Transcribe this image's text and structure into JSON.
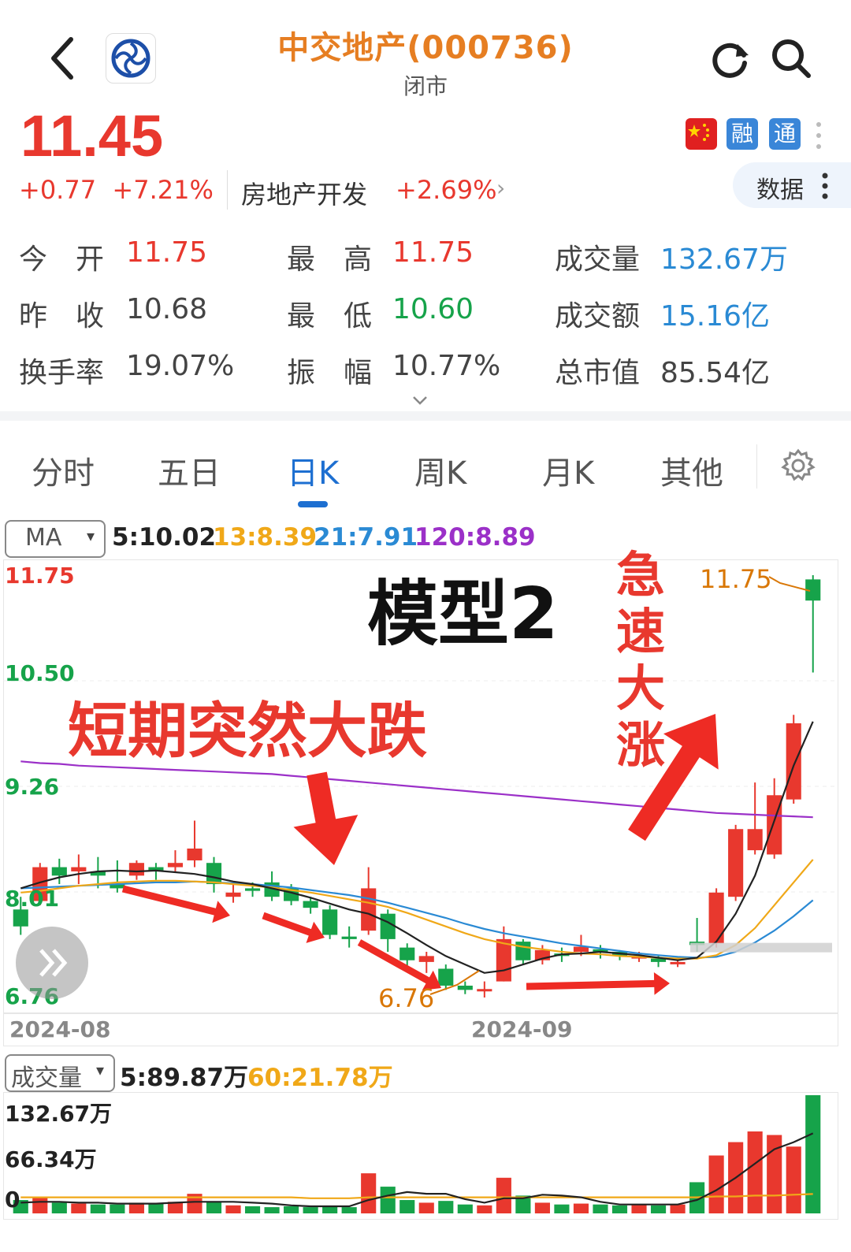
{
  "header": {
    "title": "中交地产(000736)",
    "status": "闭市"
  },
  "quote": {
    "price": "11.45",
    "change": "+0.77",
    "change_pct": "+7.21%",
    "sector": "房地产开发",
    "sector_change": "+2.69%",
    "badges": {
      "rong": "融",
      "tong": "通"
    },
    "data_button": "数据"
  },
  "stats": {
    "open_label": "今　开",
    "open_value": "11.75",
    "high_label": "最　高",
    "high_value": "11.75",
    "volume_label": "成交量",
    "volume_value": "132.67万",
    "prev_close_label": "昨　收",
    "prev_close_value": "10.68",
    "low_label": "最　低",
    "low_value": "10.60",
    "amount_label": "成交额",
    "amount_value": "15.16亿",
    "turnover_label": "换手率",
    "turnover_value": "19.07%",
    "amplitude_label": "振　幅",
    "amplitude_value": "10.77%",
    "mktcap_label": "总市值",
    "mktcap_value": "85.54亿"
  },
  "tabs": [
    "分时",
    "五日",
    "日K",
    "周K",
    "月K",
    "其他"
  ],
  "active_tab": "日K",
  "ma_selector": "MA",
  "ma_values": {
    "ma5": "5:10.02",
    "ma13": "13:8.39",
    "ma21": "21:7.91",
    "ma120": "120:8.89"
  },
  "volume_selector": "成交量",
  "volume_ma": {
    "v5": "5:89.87万",
    "v60": "60:21.78万"
  },
  "annotations": {
    "model": "模型2",
    "drop": "短期突然大跌",
    "surge_chars": [
      "急",
      "速",
      "大",
      "涨"
    ],
    "high_label": "11.75",
    "low_label": "6.76"
  },
  "colors": {
    "up": "#e8382e",
    "down": "#16a34a",
    "ma5": "#222222",
    "ma13": "#f0a818",
    "ma21": "#2a8ad4",
    "ma120": "#9b30c8",
    "title": "#e67e22"
  },
  "chart_data": {
    "type": "candlestick",
    "y_axis_labels": [
      "11.75",
      "10.50",
      "9.26",
      "8.01",
      "6.76"
    ],
    "ylim": [
      6.76,
      11.75
    ],
    "x_axis_labels": [
      "2024-08",
      "2024-09"
    ],
    "candles": [
      {
        "o": 7.8,
        "c": 7.6,
        "h": 7.95,
        "l": 7.5
      },
      {
        "o": 7.9,
        "c": 8.3,
        "h": 8.35,
        "l": 7.85
      },
      {
        "o": 8.3,
        "c": 8.2,
        "h": 8.4,
        "l": 8.1
      },
      {
        "o": 8.25,
        "c": 8.3,
        "h": 8.45,
        "l": 8.1
      },
      {
        "o": 8.25,
        "c": 8.2,
        "h": 8.42,
        "l": 8.05
      },
      {
        "o": 8.1,
        "c": 8.05,
        "h": 8.38,
        "l": 8.0
      },
      {
        "o": 8.2,
        "c": 8.35,
        "h": 8.38,
        "l": 8.15
      },
      {
        "o": 8.3,
        "c": 8.25,
        "h": 8.35,
        "l": 8.15
      },
      {
        "o": 8.3,
        "c": 8.35,
        "h": 8.5,
        "l": 8.25
      },
      {
        "o": 8.38,
        "c": 8.52,
        "h": 8.85,
        "l": 8.3
      },
      {
        "o": 8.35,
        "c": 8.1,
        "h": 8.42,
        "l": 8.0
      },
      {
        "o": 7.95,
        "c": 8.0,
        "h": 8.1,
        "l": 7.88
      },
      {
        "o": 8.05,
        "c": 8.02,
        "h": 8.12,
        "l": 7.95
      },
      {
        "o": 8.12,
        "c": 7.95,
        "h": 8.25,
        "l": 7.9
      },
      {
        "o": 8.05,
        "c": 7.9,
        "h": 8.1,
        "l": 7.85
      },
      {
        "o": 7.9,
        "c": 7.82,
        "h": 7.95,
        "l": 7.75
      },
      {
        "o": 7.8,
        "c": 7.5,
        "h": 7.85,
        "l": 7.45
      },
      {
        "o": 7.48,
        "c": 7.45,
        "h": 7.6,
        "l": 7.35
      },
      {
        "o": 7.55,
        "c": 8.05,
        "h": 8.3,
        "l": 7.5
      },
      {
        "o": 7.75,
        "c": 7.45,
        "h": 7.8,
        "l": 7.3
      },
      {
        "o": 7.35,
        "c": 7.2,
        "h": 7.4,
        "l": 7.1
      },
      {
        "o": 7.18,
        "c": 7.25,
        "h": 7.3,
        "l": 7.05
      },
      {
        "o": 7.1,
        "c": 6.9,
        "h": 7.15,
        "l": 6.85
      },
      {
        "o": 6.9,
        "c": 6.85,
        "h": 6.95,
        "l": 6.8
      },
      {
        "o": 6.84,
        "c": 6.86,
        "h": 6.95,
        "l": 6.76
      },
      {
        "o": 6.95,
        "c": 7.45,
        "h": 7.6,
        "l": 6.95
      },
      {
        "o": 7.42,
        "c": 7.2,
        "h": 7.45,
        "l": 7.15
      },
      {
        "o": 7.2,
        "c": 7.32,
        "h": 7.38,
        "l": 7.15
      },
      {
        "o": 7.28,
        "c": 7.25,
        "h": 7.35,
        "l": 7.18
      },
      {
        "o": 7.3,
        "c": 7.36,
        "h": 7.5,
        "l": 7.25
      },
      {
        "o": 7.33,
        "c": 7.3,
        "h": 7.38,
        "l": 7.22
      },
      {
        "o": 7.3,
        "c": 7.25,
        "h": 7.32,
        "l": 7.2
      },
      {
        "o": 7.22,
        "c": 7.25,
        "h": 7.3,
        "l": 7.18
      },
      {
        "o": 7.22,
        "c": 7.18,
        "h": 7.25,
        "l": 7.12
      },
      {
        "o": 7.16,
        "c": 7.18,
        "h": 7.22,
        "l": 7.12
      },
      {
        "o": 7.42,
        "c": 7.38,
        "h": 7.7,
        "l": 7.3
      },
      {
        "o": 7.4,
        "c": 8.0,
        "h": 8.05,
        "l": 7.35
      },
      {
        "o": 7.95,
        "c": 8.75,
        "h": 8.8,
        "l": 7.9
      },
      {
        "o": 8.5,
        "c": 8.75,
        "h": 9.3,
        "l": 8.45
      },
      {
        "o": 8.45,
        "c": 9.15,
        "h": 9.35,
        "l": 8.4
      },
      {
        "o": 9.1,
        "c": 10.0,
        "h": 10.1,
        "l": 9.05
      },
      {
        "o": 11.7,
        "c": 11.45,
        "h": 11.75,
        "l": 10.6
      }
    ],
    "ma5": [
      8.05,
      8.12,
      8.18,
      8.22,
      8.25,
      8.26,
      8.25,
      8.26,
      8.24,
      8.22,
      8.18,
      8.13,
      8.1,
      8.05,
      8.0,
      7.94,
      7.87,
      7.8,
      7.75,
      7.65,
      7.52,
      7.38,
      7.25,
      7.15,
      7.05,
      7.08,
      7.15,
      7.22,
      7.27,
      7.28,
      7.3,
      7.28,
      7.26,
      7.23,
      7.2,
      7.23,
      7.42,
      7.75,
      8.2,
      8.85,
      9.5,
      10.02
    ],
    "ma13": [
      8.0,
      8.02,
      8.05,
      8.08,
      8.1,
      8.12,
      8.13,
      8.14,
      8.14,
      8.13,
      8.12,
      8.1,
      8.08,
      8.06,
      8.03,
      8.0,
      7.96,
      7.92,
      7.88,
      7.83,
      7.76,
      7.68,
      7.6,
      7.52,
      7.45,
      7.4,
      7.36,
      7.33,
      7.3,
      7.28,
      7.27,
      7.25,
      7.24,
      7.23,
      7.22,
      7.22,
      7.26,
      7.38,
      7.58,
      7.85,
      8.12,
      8.39
    ],
    "ma21": [
      8.05,
      8.06,
      8.07,
      8.08,
      8.09,
      8.1,
      8.11,
      8.12,
      8.12,
      8.13,
      8.12,
      8.11,
      8.1,
      8.08,
      8.06,
      8.03,
      8.0,
      7.97,
      7.93,
      7.88,
      7.82,
      7.76,
      7.7,
      7.63,
      7.57,
      7.52,
      7.48,
      7.44,
      7.4,
      7.37,
      7.34,
      7.31,
      7.28,
      7.26,
      7.24,
      7.23,
      7.24,
      7.3,
      7.41,
      7.55,
      7.72,
      7.91
    ],
    "ma120": [
      9.55,
      9.53,
      9.52,
      9.5,
      9.49,
      9.48,
      9.47,
      9.46,
      9.45,
      9.44,
      9.43,
      9.42,
      9.41,
      9.4,
      9.38,
      9.36,
      9.34,
      9.32,
      9.3,
      9.28,
      9.26,
      9.24,
      9.22,
      9.2,
      9.18,
      9.16,
      9.14,
      9.12,
      9.1,
      9.08,
      9.06,
      9.04,
      9.02,
      9.0,
      8.98,
      8.96,
      8.94,
      8.93,
      8.92,
      8.91,
      8.9,
      8.89
    ],
    "volume_axis_labels": [
      "132.67万",
      "66.34万",
      "0"
    ],
    "volume_max": 132.67,
    "volumes": [
      15,
      18,
      12,
      11,
      10,
      10,
      12,
      11,
      13,
      22,
      13,
      9,
      8,
      7,
      8,
      7,
      8,
      7,
      45,
      30,
      15,
      12,
      14,
      10,
      9,
      40,
      20,
      12,
      10,
      11,
      10,
      9,
      10,
      9,
      10,
      35,
      65,
      80,
      92,
      88,
      75,
      132.67
    ],
    "volume_ma5": [
      12,
      13,
      13,
      12,
      12,
      11,
      11,
      11,
      12,
      13,
      13,
      13,
      12,
      11,
      9,
      8,
      8,
      8,
      15,
      20,
      24,
      22,
      22,
      16,
      12,
      17,
      17,
      21,
      20,
      18,
      13,
      10,
      10,
      10,
      10,
      15,
      26,
      40,
      56,
      72,
      80,
      89.87
    ],
    "volume_ma60": [
      18,
      18,
      18,
      18,
      18,
      18,
      18,
      18,
      18,
      18,
      18,
      18,
      18,
      18,
      18,
      17,
      17,
      17,
      18,
      18,
      18,
      18,
      18,
      18,
      18,
      18,
      18,
      18,
      18,
      18,
      18,
      18,
      18,
      18,
      18,
      18,
      19,
      19,
      20,
      20,
      21,
      21.78
    ]
  }
}
